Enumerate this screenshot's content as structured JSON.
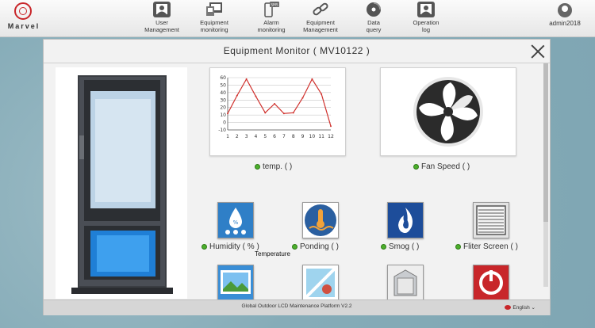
{
  "brand": {
    "name": "Marvel"
  },
  "nav": [
    {
      "label_1": "User",
      "label_2": "Management",
      "icon": "user-card-icon"
    },
    {
      "label_1": "Equipment",
      "label_2": "monitoring",
      "icon": "monitor-icon"
    },
    {
      "label_1": "Alarm",
      "label_2": "monitoring",
      "icon": "sms-phone-icon"
    },
    {
      "label_1": "Equipment",
      "label_2": "Management",
      "icon": "link-icon"
    },
    {
      "label_1": "Data",
      "label_2": "query",
      "icon": "disc-icon"
    },
    {
      "label_1": "Operation",
      "label_2": "log",
      "icon": "user-card-icon"
    }
  ],
  "user": {
    "name": "admin2018"
  },
  "modal": {
    "title": "Equipment Monitor ( MV10122 )",
    "temp_label": "temp.  (   )",
    "fan_label": "Fan Speed  (   )",
    "sensors": [
      {
        "label": "Humidity  ( %  )",
        "icon": "humidity-icon",
        "color": "#2f7fc7"
      },
      {
        "label": "Ponding  (   )",
        "icon": "ponding-icon",
        "color": "#2a5fa0"
      },
      {
        "label": "Smog  (   )",
        "icon": "smog-icon",
        "color": "#1d4d9a"
      },
      {
        "label": "Fliter Screen  (   )",
        "icon": "filter-screen-icon",
        "color": "#d8d8d8"
      }
    ],
    "tooltip": "Temperature",
    "bottom_row_icons": [
      "landscape-icon",
      "glass-icon",
      "cabinet-icon",
      "power-icon"
    ],
    "footer": "Global Outdoor LCD Maintenance Platform V2.2",
    "language": "English"
  },
  "chart_data": {
    "type": "line",
    "x": [
      1,
      2,
      3,
      4,
      5,
      6,
      7,
      8,
      9,
      10,
      11,
      12
    ],
    "y": [
      12,
      36,
      58,
      35,
      13,
      25,
      12,
      13,
      33,
      58,
      38,
      -5
    ],
    "y_ticks": [
      60,
      50,
      40,
      30,
      20,
      10,
      0,
      -10
    ],
    "x_ticks": [
      "1",
      "2",
      "3",
      "4",
      "5",
      "6",
      "7",
      "8",
      "9",
      "10",
      "11",
      "12"
    ],
    "ylim": [
      -10,
      60
    ],
    "color": "#d0312d",
    "grid": true
  }
}
